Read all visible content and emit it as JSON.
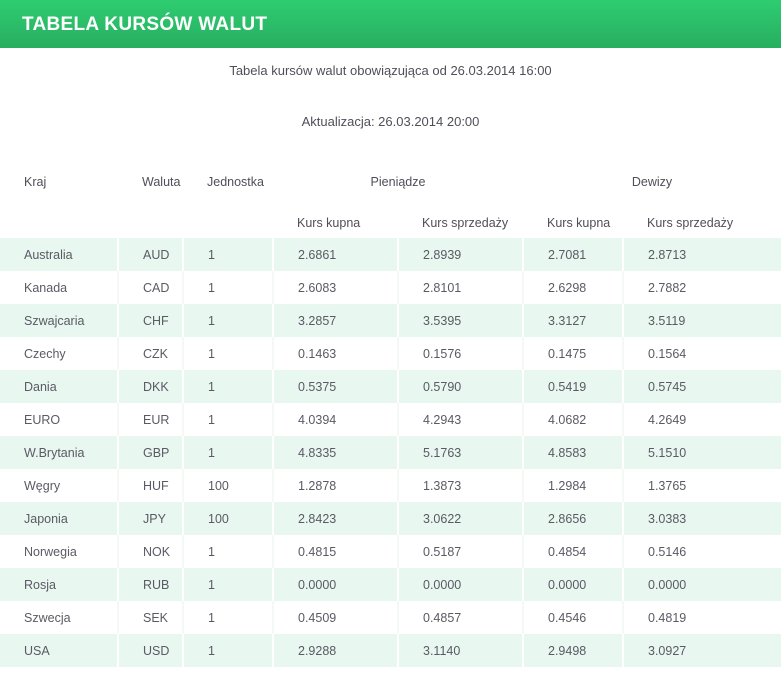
{
  "header": {
    "title": "TABELA KURSÓW WALUT",
    "bar_color_top": "#2ecc71",
    "bar_color_bottom": "#27ae60",
    "title_color": "#ffffff"
  },
  "info": {
    "validity_line": "Tabela kursów walut obowiązująca od 26.03.2014 16:00",
    "update_line": "Aktualizacja: 26.03.2014 20:00"
  },
  "table": {
    "group_headers": {
      "kraj": "Kraj",
      "waluta": "Waluta",
      "jednostka": "Jednostka",
      "pieniadze": "Pieniądze",
      "dewizy": "Dewizy"
    },
    "sub_headers": {
      "pieniadze_kupna": "Kurs kupna",
      "pieniadze_sprzedazy": "Kurs sprzedaży",
      "dewizy_kupna": "Kurs kupna",
      "dewizy_sprzedazy": "Kurs sprzedaży"
    },
    "row_color_odd": "#e8f7ef",
    "row_color_even": "#ffffff",
    "rows": [
      {
        "kraj": "Australia",
        "waluta": "AUD",
        "jednostka": "1",
        "pieniadze_kupna": "2.6861",
        "pieniadze_sprzedazy": "2.8939",
        "dewizy_kupna": "2.7081",
        "dewizy_sprzedazy": "2.8713"
      },
      {
        "kraj": "Kanada",
        "waluta": "CAD",
        "jednostka": "1",
        "pieniadze_kupna": "2.6083",
        "pieniadze_sprzedazy": "2.8101",
        "dewizy_kupna": "2.6298",
        "dewizy_sprzedazy": "2.7882"
      },
      {
        "kraj": "Szwajcaria",
        "waluta": "CHF",
        "jednostka": "1",
        "pieniadze_kupna": "3.2857",
        "pieniadze_sprzedazy": "3.5395",
        "dewizy_kupna": "3.3127",
        "dewizy_sprzedazy": "3.5119"
      },
      {
        "kraj": "Czechy",
        "waluta": "CZK",
        "jednostka": "1",
        "pieniadze_kupna": "0.1463",
        "pieniadze_sprzedazy": "0.1576",
        "dewizy_kupna": "0.1475",
        "dewizy_sprzedazy": "0.1564"
      },
      {
        "kraj": "Dania",
        "waluta": "DKK",
        "jednostka": "1",
        "pieniadze_kupna": "0.5375",
        "pieniadze_sprzedazy": "0.5790",
        "dewizy_kupna": "0.5419",
        "dewizy_sprzedazy": "0.5745"
      },
      {
        "kraj": "EURO",
        "waluta": "EUR",
        "jednostka": "1",
        "pieniadze_kupna": "4.0394",
        "pieniadze_sprzedazy": "4.2943",
        "dewizy_kupna": "4.0682",
        "dewizy_sprzedazy": "4.2649"
      },
      {
        "kraj": "W.Brytania",
        "waluta": "GBP",
        "jednostka": "1",
        "pieniadze_kupna": "4.8335",
        "pieniadze_sprzedazy": "5.1763",
        "dewizy_kupna": "4.8583",
        "dewizy_sprzedazy": "5.1510"
      },
      {
        "kraj": "Węgry",
        "waluta": "HUF",
        "jednostka": "100",
        "pieniadze_kupna": "1.2878",
        "pieniadze_sprzedazy": "1.3873",
        "dewizy_kupna": "1.2984",
        "dewizy_sprzedazy": "1.3765"
      },
      {
        "kraj": "Japonia",
        "waluta": "JPY",
        "jednostka": "100",
        "pieniadze_kupna": "2.8423",
        "pieniadze_sprzedazy": "3.0622",
        "dewizy_kupna": "2.8656",
        "dewizy_sprzedazy": "3.0383"
      },
      {
        "kraj": "Norwegia",
        "waluta": "NOK",
        "jednostka": "1",
        "pieniadze_kupna": "0.4815",
        "pieniadze_sprzedazy": "0.5187",
        "dewizy_kupna": "0.4854",
        "dewizy_sprzedazy": "0.5146"
      },
      {
        "kraj": "Rosja",
        "waluta": "RUB",
        "jednostka": "1",
        "pieniadze_kupna": "0.0000",
        "pieniadze_sprzedazy": "0.0000",
        "dewizy_kupna": "0.0000",
        "dewizy_sprzedazy": "0.0000"
      },
      {
        "kraj": "Szwecja",
        "waluta": "SEK",
        "jednostka": "1",
        "pieniadze_kupna": "0.4509",
        "pieniadze_sprzedazy": "0.4857",
        "dewizy_kupna": "0.4546",
        "dewizy_sprzedazy": "0.4819"
      },
      {
        "kraj": "USA",
        "waluta": "USD",
        "jednostka": "1",
        "pieniadze_kupna": "2.9288",
        "pieniadze_sprzedazy": "3.1140",
        "dewizy_kupna": "2.9498",
        "dewizy_sprzedazy": "3.0927"
      }
    ]
  }
}
